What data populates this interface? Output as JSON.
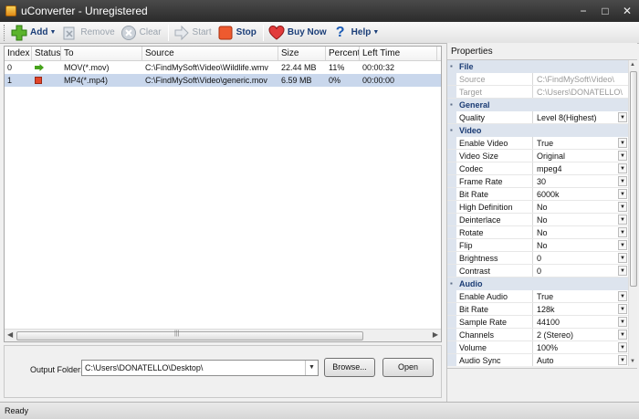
{
  "window": {
    "title": "uConverter - Unregistered",
    "controls": [
      "−",
      "□",
      "✕"
    ]
  },
  "toolbar": {
    "add": "Add",
    "remove": "Remove",
    "clear": "Clear",
    "start": "Start",
    "stop": "Stop",
    "buy_now": "Buy Now",
    "help": "Help"
  },
  "list": {
    "columns": [
      "Index",
      "Status",
      "To",
      "Source",
      "Size",
      "Percent",
      "Left Time"
    ],
    "rows": [
      {
        "index": "0",
        "status": "ready",
        "to": "MOV(*.mov)",
        "source": "C:\\FindMySoft\\Video\\Wildlife.wmv",
        "size": "22.44 MB",
        "percent": "11%",
        "left_time": "00:00:32"
      },
      {
        "index": "1",
        "status": "stopped",
        "to": "MP4(*.mp4)",
        "source": "C:\\FindMySoft\\Video\\generic.mov",
        "size": "6.59 MB",
        "percent": "0%",
        "left_time": "00:00:00"
      }
    ]
  },
  "output": {
    "label": "Output Folder:",
    "path": "C:\\Users\\DONATELLO\\Desktop\\",
    "browse": "Browse...",
    "open": "Open"
  },
  "properties": {
    "title": "Properties",
    "file": {
      "category": "File",
      "source_label": "Source",
      "source_value": "C:\\FindMySoft\\Video\\",
      "target_label": "Target",
      "target_value": "C:\\Users\\DONATELLO\\"
    },
    "general": {
      "category": "General",
      "quality_label": "Quality",
      "quality_value": "Level 8(Highest)"
    },
    "video": {
      "category": "Video",
      "items": [
        {
          "label": "Enable Video",
          "value": "True"
        },
        {
          "label": "Video Size",
          "value": "Original"
        },
        {
          "label": "Codec",
          "value": "mpeg4"
        },
        {
          "label": "Frame Rate",
          "value": "30"
        },
        {
          "label": "Bit Rate",
          "value": "6000k"
        },
        {
          "label": "High Definition",
          "value": "No"
        },
        {
          "label": "Deinterlace",
          "value": "No"
        },
        {
          "label": "Rotate",
          "value": "No"
        },
        {
          "label": "Flip",
          "value": "No"
        },
        {
          "label": "Brightness",
          "value": "0"
        },
        {
          "label": "Contrast",
          "value": "0"
        }
      ]
    },
    "audio": {
      "category": "Audio",
      "items": [
        {
          "label": "Enable Audio",
          "value": "True"
        },
        {
          "label": "Bit Rate",
          "value": "128k"
        },
        {
          "label": "Sample Rate",
          "value": "44100"
        },
        {
          "label": "Channels",
          "value": "2 (Stereo)"
        },
        {
          "label": "Volume",
          "value": "100%"
        },
        {
          "label": "Audio Sync",
          "value": "Auto"
        }
      ]
    }
  },
  "status_bar": {
    "text": "Ready"
  }
}
